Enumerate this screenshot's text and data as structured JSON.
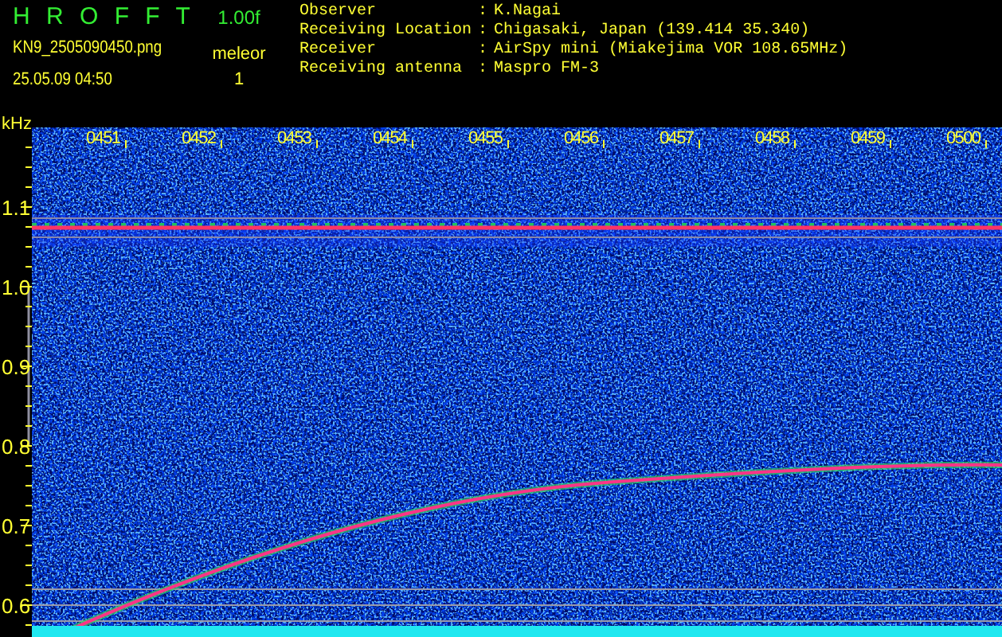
{
  "header": {
    "title": "H R O F F T",
    "version": "1.00f",
    "filename": "KN9_2505090450.png",
    "mode": "meleor",
    "datetime": "25.05.09 04:50",
    "count": "1"
  },
  "info": [
    {
      "label": "Observer",
      "separator": ":",
      "value": "K.Nagai"
    },
    {
      "label": "Receiving Location",
      "separator": ":",
      "value": "Chigasaki, Japan (139.414 35.340)"
    },
    {
      "label": "Receiver",
      "separator": ":",
      "value": "AirSpy mini (Miakejima VOR 108.65MHz)"
    },
    {
      "label": "Receiving antenna",
      "separator": ":",
      "value": "Maspro FM-3"
    }
  ],
  "spectrogram": {
    "unit": "kHz",
    "y_labels": [
      "1.1",
      "1.0",
      "0.9",
      "0.8",
      "0.7",
      "0.6"
    ],
    "time_labels": [
      "0451",
      "0452",
      "0453",
      "0454",
      "0455",
      "0456",
      "0457",
      "0458",
      "0459",
      "0500"
    ]
  }
}
